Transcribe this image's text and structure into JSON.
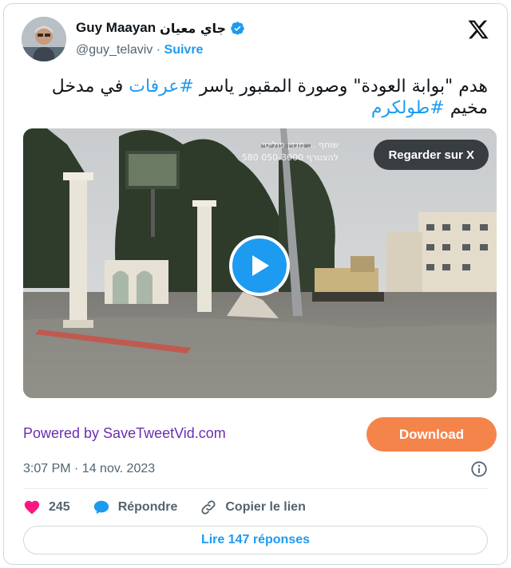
{
  "author": {
    "display_name_latin": "Guy Maayan",
    "display_name_arabic": "جاي معيان",
    "handle": "@guy_telaviv",
    "separator": "·",
    "follow_label": "Suivre"
  },
  "tweet": {
    "line1_prefix": "هدم \"بوابة العودة\" وصورة المقبور ياسر ",
    "hashtag1": "#عرفات",
    "line1_suffix": " في مدخل",
    "line2_prefix": "مخيم ",
    "hashtag2": "#طولكرم"
  },
  "media": {
    "watch_label": "Regarder sur X",
    "overlay_line1": "שותף ... מגזין פוליטי",
    "overlay_line2": "להצטרף 050-3000 580"
  },
  "promo": {
    "powered_text": "Powered by SaveTweetVid.com",
    "download_label": "Download"
  },
  "meta": {
    "timestamp": "3:07 PM · 14 nov. 2023"
  },
  "actions": {
    "like_count": "245",
    "reply_label": "Répondre",
    "copy_label": "Copier le lien"
  },
  "read_replies_label": "Lire 147 réponses",
  "colors": {
    "accent": "#1d9bf0",
    "like": "#f91880",
    "download": "#f5844a",
    "powered": "#6a2fb0"
  }
}
